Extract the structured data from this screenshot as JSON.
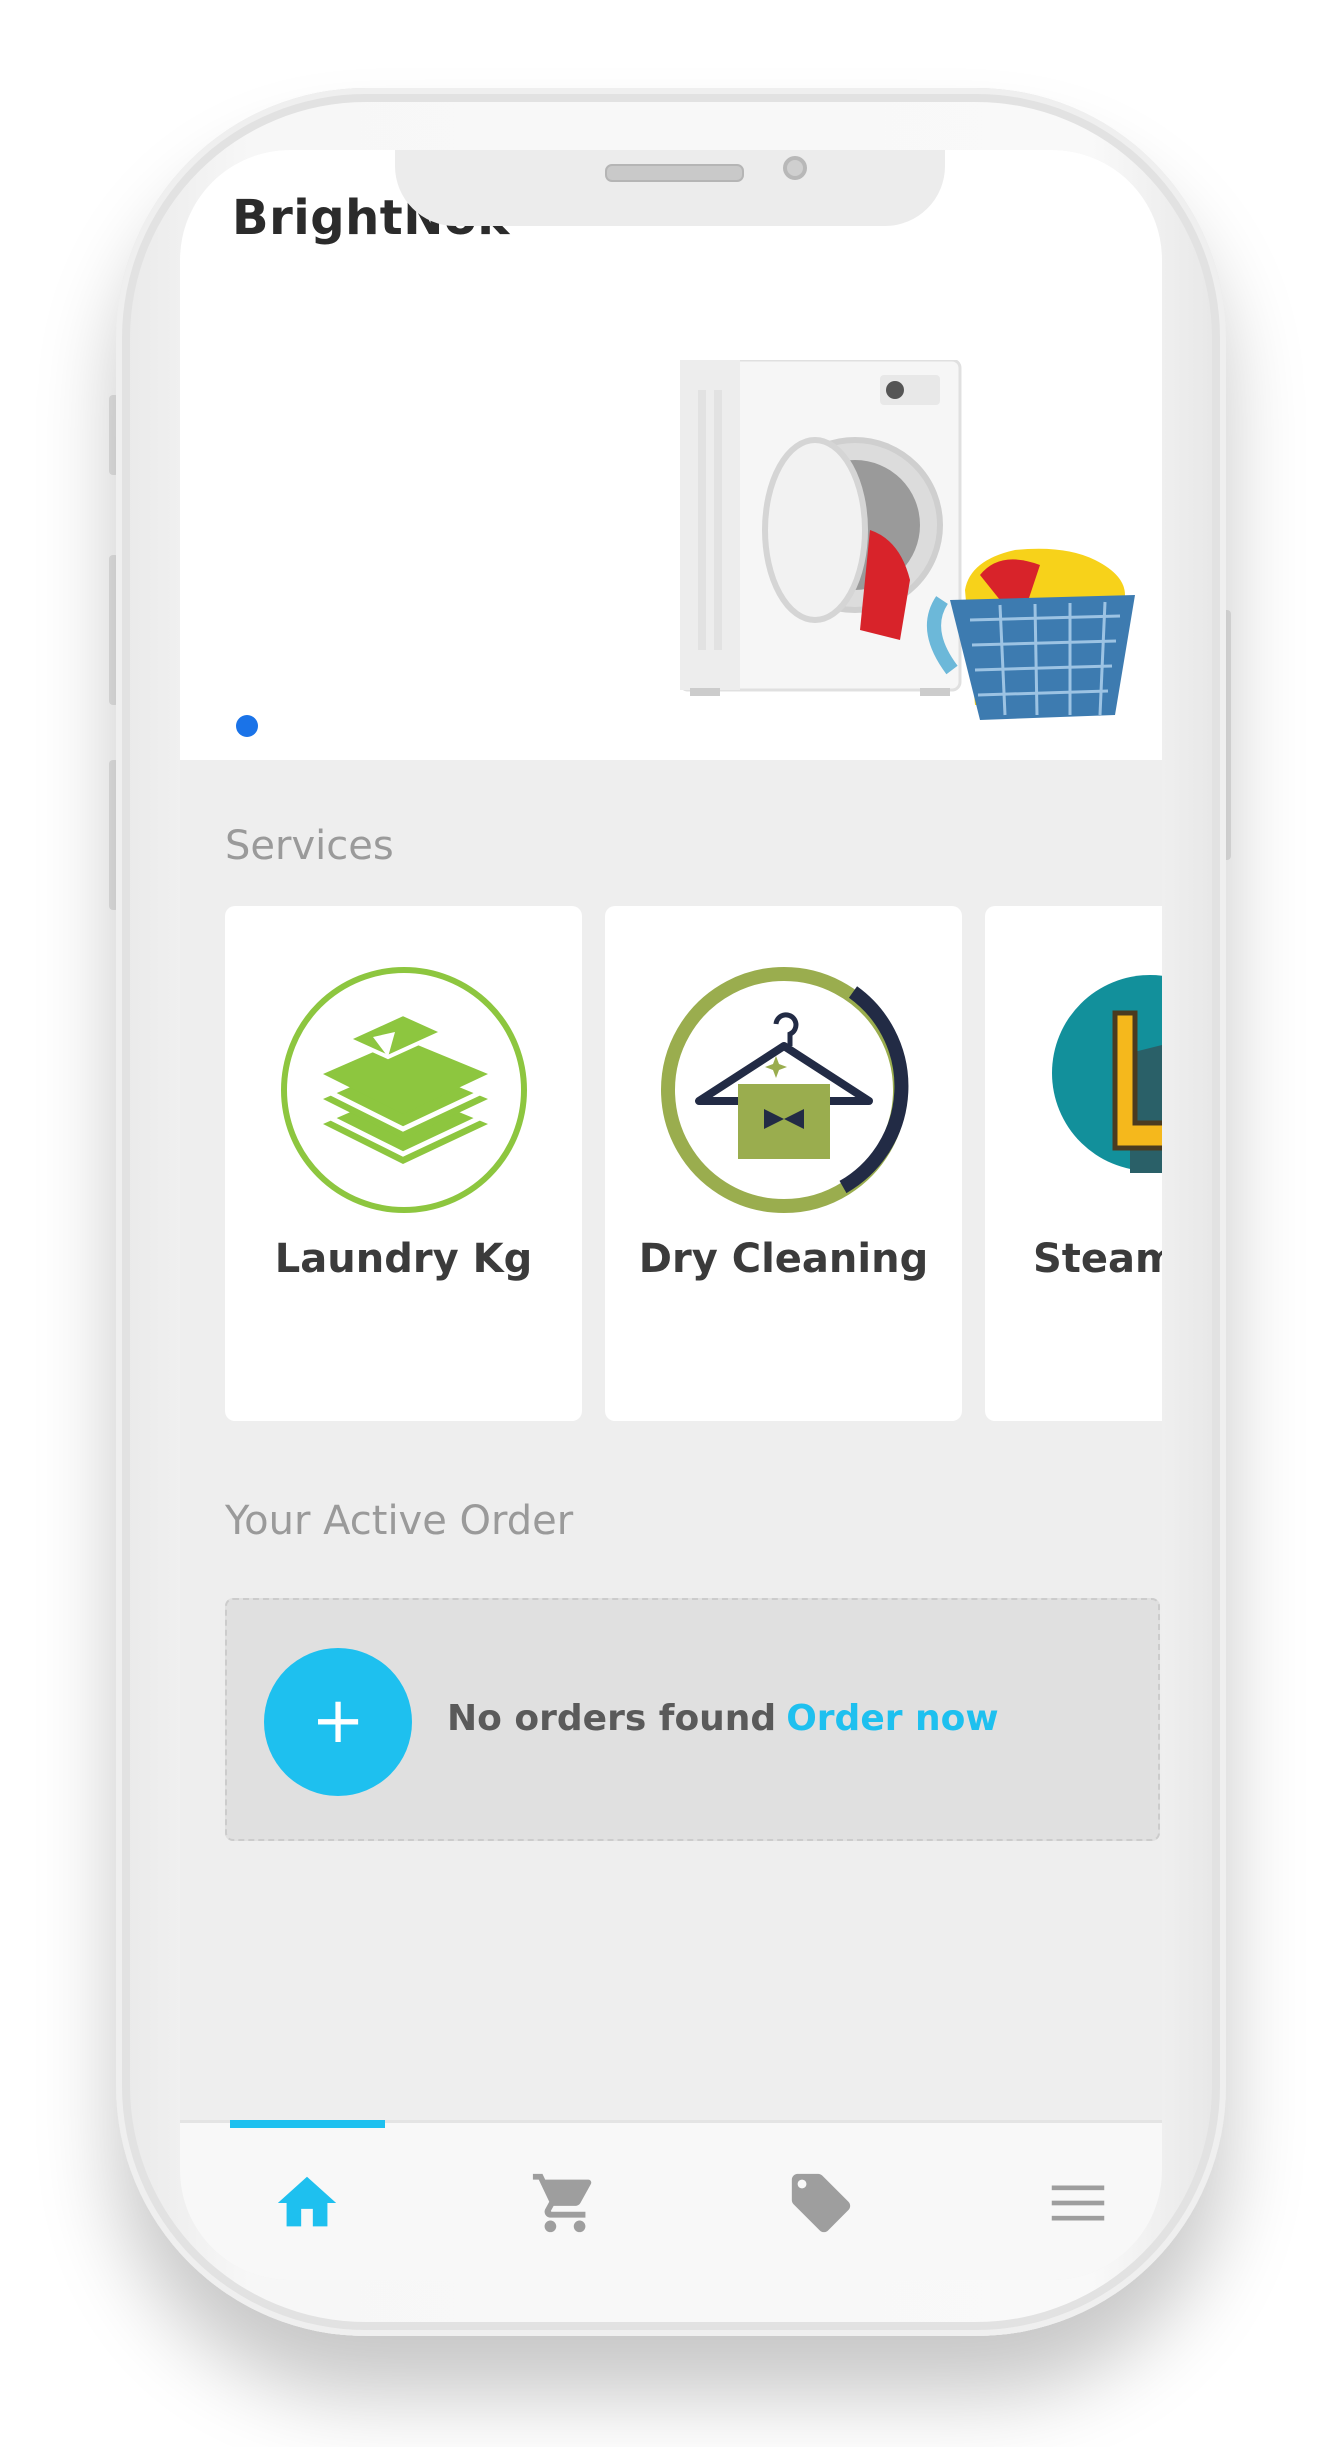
{
  "app": {
    "title": "BrightNok"
  },
  "banner": {
    "dots": 1,
    "active_dot": 0,
    "image": "washing-machine-with-laundry-basket"
  },
  "services": {
    "title": "Services",
    "items": [
      {
        "label": "Laundry Kg",
        "icon": "folded-shirts-icon"
      },
      {
        "label": "Dry Cleaning",
        "icon": "hanger-icon"
      },
      {
        "label": "Steam",
        "icon": "iron-icon"
      }
    ]
  },
  "active_order": {
    "title": "Your Active Order",
    "add_symbol": "+",
    "empty_text": "No orders found",
    "link_text": "Order now"
  },
  "bottom_nav": {
    "items": [
      {
        "icon": "home-icon",
        "active": true
      },
      {
        "icon": "cart-icon",
        "active": false
      },
      {
        "icon": "tag-icon",
        "active": false
      },
      {
        "icon": "menu-icon",
        "active": false
      }
    ]
  },
  "colors": {
    "accent": "#1ec0ef",
    "dot": "#1a73e8",
    "laundry_green": "#8dc63f",
    "dryclean_olive": "#9aad4e",
    "dryclean_navy": "#222b45",
    "steam_teal": "#12909b"
  }
}
